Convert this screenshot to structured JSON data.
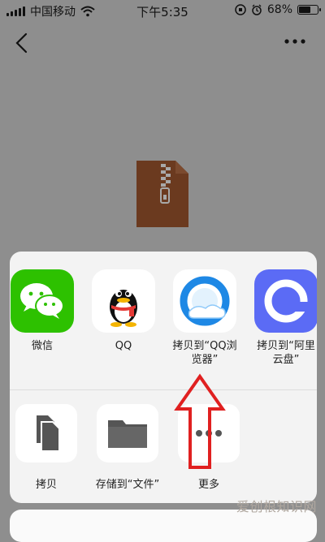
{
  "status_bar": {
    "carrier": "中国移动",
    "time": "下午5:35",
    "battery_percent": "68%",
    "battery_level": 0.68
  },
  "nav": {
    "back_icon": "chevron-left-icon",
    "more_icon": "more-horizontal-icon"
  },
  "file_icon": "zip-file-icon",
  "share_apps": [
    {
      "label": "微信",
      "icon": "wechat-icon"
    },
    {
      "label": "QQ",
      "icon": "qq-icon"
    },
    {
      "label": "拷贝到“QQ浏览器”",
      "icon": "qq-browser-icon"
    },
    {
      "label": "拷贝到“阿里云盘”",
      "icon": "aliyun-drive-icon"
    }
  ],
  "actions": [
    {
      "label": "拷贝",
      "icon": "copy-icon"
    },
    {
      "label": "存储到“文件”",
      "icon": "folder-icon"
    },
    {
      "label": "更多",
      "icon": "more-icon"
    }
  ],
  "annotation": {
    "arrow_color": "#e02020"
  },
  "watermark": "爱创根知识网"
}
